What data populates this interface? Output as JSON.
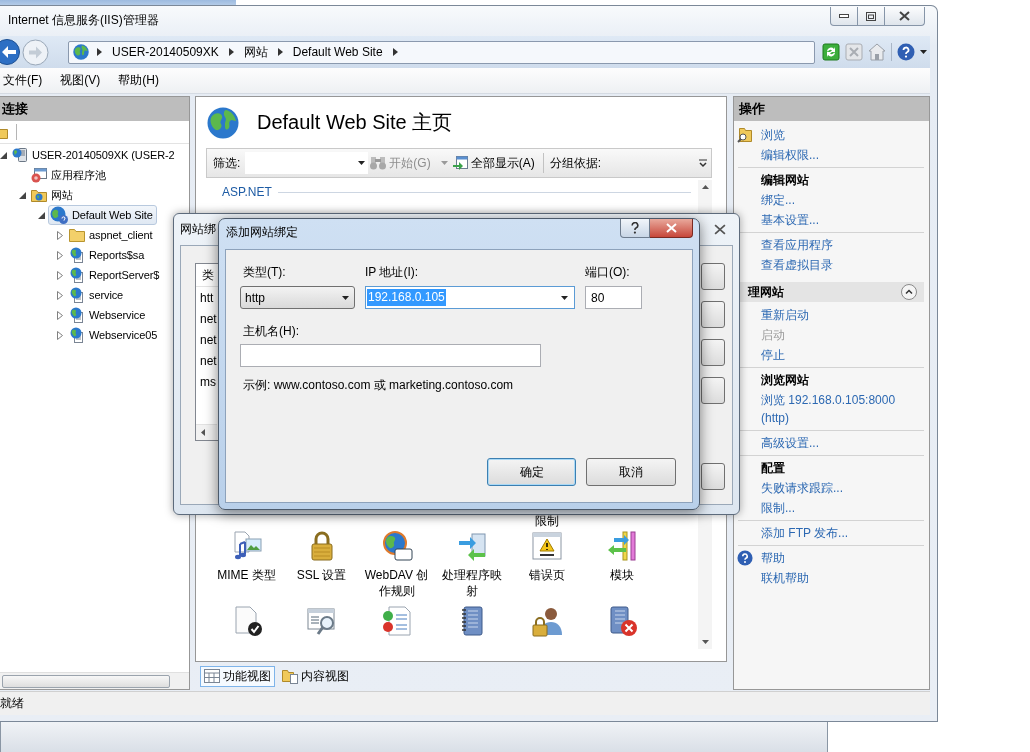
{
  "window": {
    "title": "Internet 信息服务(IIS)管理器"
  },
  "address_bar": {
    "crumbs": [
      "USER-20140509XK",
      "网站",
      "Default Web Site"
    ]
  },
  "menu": [
    {
      "label": "文件(F)"
    },
    {
      "label": "视图(V)"
    },
    {
      "label": "帮助(H)"
    }
  ],
  "connections": {
    "title": "连接",
    "tree": [
      {
        "label": "USER-20140509XK (USER-2",
        "kind": "server",
        "expandable": true,
        "expanded": true,
        "selected": false,
        "children": [
          {
            "label": "应用程序池",
            "kind": "pool",
            "expandable": false,
            "selected": false
          },
          {
            "label": "网站",
            "kind": "sites",
            "expandable": true,
            "expanded": true,
            "selected": false,
            "children": [
              {
                "label": "Default Web Site",
                "kind": "site",
                "expandable": true,
                "expanded": true,
                "selected": true,
                "children": [
                  {
                    "label": "aspnet_client",
                    "kind": "folder",
                    "expandable": true,
                    "expanded": false,
                    "selected": false
                  },
                  {
                    "label": "Reports$sa",
                    "kind": "app",
                    "expandable": true,
                    "expanded": false,
                    "selected": false
                  },
                  {
                    "label": "ReportServer$",
                    "kind": "app",
                    "expandable": true,
                    "expanded": false,
                    "selected": false
                  },
                  {
                    "label": "service",
                    "kind": "app",
                    "expandable": true,
                    "expanded": false,
                    "selected": false
                  },
                  {
                    "label": "Webservice",
                    "kind": "app",
                    "expandable": true,
                    "expanded": false,
                    "selected": false
                  },
                  {
                    "label": "Webservice05",
                    "kind": "app",
                    "expandable": true,
                    "expanded": false,
                    "selected": false
                  }
                ]
              }
            ]
          }
        ]
      }
    ]
  },
  "home": {
    "title": "Default Web Site 主页",
    "filter": {
      "label": "筛选:",
      "go": "开始(G)",
      "go_disabled": true,
      "show_all": "全部显示(A)",
      "group_by": "分组依据:"
    },
    "group": "ASP.NET",
    "label_fragment": "限制",
    "features": [
      {
        "label": "MIME 类型",
        "kind": "mime"
      },
      {
        "label": "SSL 设置",
        "kind": "ssl"
      },
      {
        "label": "WebDAV 创作规则",
        "kind": "webdav"
      },
      {
        "label": "处理程序映射",
        "kind": "handler"
      },
      {
        "label": "错误页",
        "kind": "error"
      },
      {
        "label": "模块",
        "kind": "modules"
      }
    ],
    "features_cut": [
      {
        "kind": "document"
      },
      {
        "kind": "browse"
      },
      {
        "kind": "filter"
      },
      {
        "kind": "log"
      },
      {
        "kind": "auth"
      },
      {
        "kind": "failed"
      }
    ]
  },
  "view_tabs": [
    {
      "label": "功能视图",
      "selected": true
    },
    {
      "label": "内容视图",
      "selected": false
    }
  ],
  "actions": {
    "title": "操作",
    "groups": [
      {
        "sections": [
          {
            "items": [
              {
                "label": "浏览",
                "kind": "browse",
                "disabled": false
              },
              {
                "label": "编辑权限...",
                "kind": "link",
                "disabled": false
              }
            ]
          },
          {
            "heading": "编辑网站",
            "items": [
              {
                "label": "绑定...",
                "kind": "link",
                "disabled": false
              },
              {
                "label": "基本设置...",
                "kind": "link",
                "disabled": false
              }
            ]
          },
          {
            "items": [
              {
                "label": "查看应用程序",
                "kind": "link",
                "disabled": false
              },
              {
                "label": "查看虚拟目录",
                "kind": "link",
                "disabled": false
              }
            ]
          }
        ]
      },
      {
        "header": "理网站",
        "expanded": true,
        "sections": [
          {
            "items": [
              {
                "label": "重新启动",
                "kind": "link",
                "disabled": false
              },
              {
                "label": "启动",
                "kind": "link",
                "disabled": true
              },
              {
                "label": "停止",
                "kind": "link",
                "disabled": false
              }
            ]
          },
          {
            "heading": "浏览网站",
            "items": [
              {
                "label": "浏览 192.168.0.105:8000 (http)",
                "kind": "link",
                "disabled": false
              }
            ]
          },
          {
            "items": [
              {
                "label": "高级设置...",
                "kind": "link",
                "disabled": false
              }
            ]
          },
          {
            "heading": "配置",
            "items": [
              {
                "label": "失败请求跟踪...",
                "kind": "link",
                "disabled": false
              },
              {
                "label": "限制...",
                "kind": "link",
                "disabled": false
              }
            ]
          },
          {
            "items": [
              {
                "label": "添加 FTP 发布...",
                "kind": "link",
                "disabled": false
              }
            ]
          },
          {
            "items": [
              {
                "label": "帮助",
                "kind": "help",
                "disabled": false
              },
              {
                "label": "联机帮助",
                "kind": "link",
                "disabled": false
              }
            ]
          }
        ]
      }
    ]
  },
  "status_bar": {
    "text": "就绪"
  },
  "bindings_dialog": {
    "title": "网站绑",
    "column": "类",
    "rows": [
      "htt",
      "net",
      "net",
      "net",
      "ms"
    ]
  },
  "add_binding_dialog": {
    "title": "添加网站绑定",
    "type": {
      "label": "类型(T):",
      "value": "http"
    },
    "ip": {
      "label": "IP 地址(I):",
      "value": "192.168.0.105",
      "value_selected": true
    },
    "port": {
      "label": "端口(O):",
      "value": "80"
    },
    "host": {
      "label": "主机名(H):"
    },
    "example": "示例: www.contoso.com 或 marketing.contoso.com",
    "buttons": [
      {
        "label": "确定",
        "default": true
      },
      {
        "label": "取消",
        "default": false
      }
    ]
  }
}
